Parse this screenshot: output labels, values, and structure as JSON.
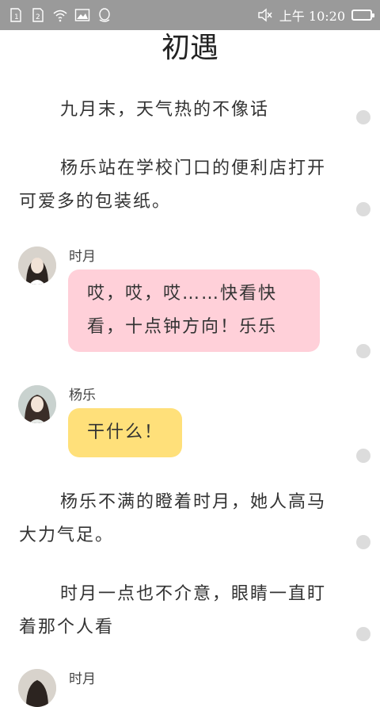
{
  "status_bar": {
    "left_icons": [
      "sim1-icon",
      "sim2-icon",
      "wifi-icon",
      "image-icon",
      "qq-icon"
    ],
    "sim1": "1",
    "sim2": "2",
    "time": "上午 10:20"
  },
  "chapter": {
    "title": "初遇"
  },
  "story": {
    "p1": "九月末，天气热的不像话",
    "p2": "杨乐站在学校门口的便利店打开可爱多的包装纸。",
    "msg1": {
      "speaker": "时月",
      "text": "哎，哎，哎……快看快看，十点钟方向！乐乐"
    },
    "msg2": {
      "speaker": "杨乐",
      "text": "干什么！"
    },
    "p3": "杨乐不满的瞪着时月，她人高马大力气足。",
    "p4": "时月一点也不介意，眼睛一直盯着那个人看",
    "msg3": {
      "speaker": "时月"
    }
  },
  "colors": {
    "status_bar_bg": "#9a9a9a",
    "bubble_pink": "#ffd0d9",
    "bubble_yellow": "#ffe07a",
    "scroll_dot": "#dcdcdc"
  }
}
